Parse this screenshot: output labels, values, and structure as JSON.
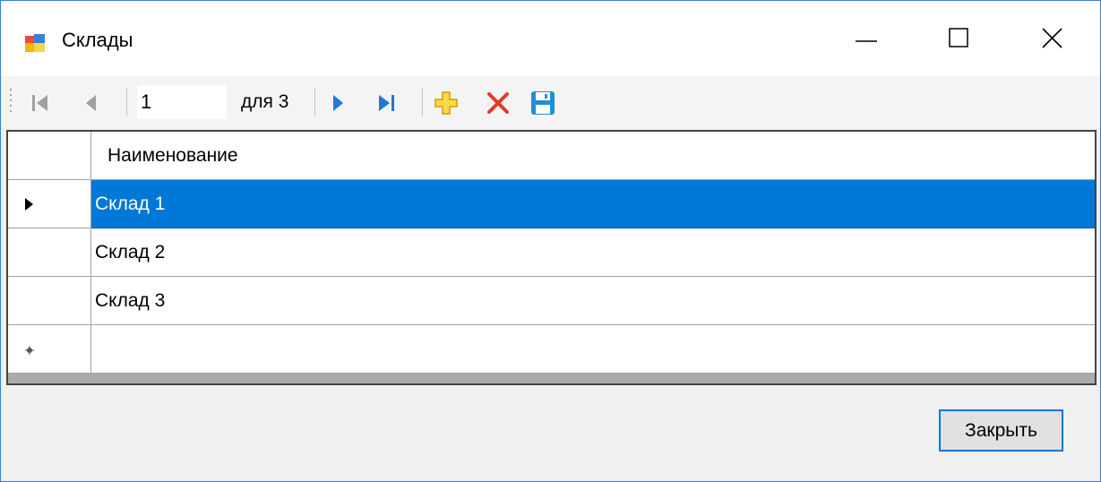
{
  "window": {
    "title": "Склады"
  },
  "navigator": {
    "position_value": "1",
    "count_label": "для 3"
  },
  "grid": {
    "column_header": "Наименование",
    "rows": [
      {
        "name": "Склад 1",
        "selected": true
      },
      {
        "name": "Склад 2",
        "selected": false
      },
      {
        "name": "Склад 3",
        "selected": false
      },
      {
        "name": "",
        "new_row": true
      }
    ]
  },
  "footer": {
    "close_label": "Закрыть"
  },
  "colors": {
    "window_border": "#3b7fd4",
    "selection": "#0078d7",
    "nav_active": "#1e78d7",
    "nav_disabled": "#a0a0a0",
    "add_icon": "#f0b400",
    "delete_icon": "#e23b2a",
    "save_icon": "#1e8fd5"
  },
  "icons": [
    "app-forms-icon",
    "minimize-icon",
    "maximize-icon",
    "close-icon",
    "move-first-icon",
    "move-previous-icon",
    "move-next-icon",
    "move-last-icon",
    "add-new-icon",
    "delete-icon",
    "save-icon",
    "current-row-indicator-icon",
    "new-row-indicator-icon"
  ]
}
